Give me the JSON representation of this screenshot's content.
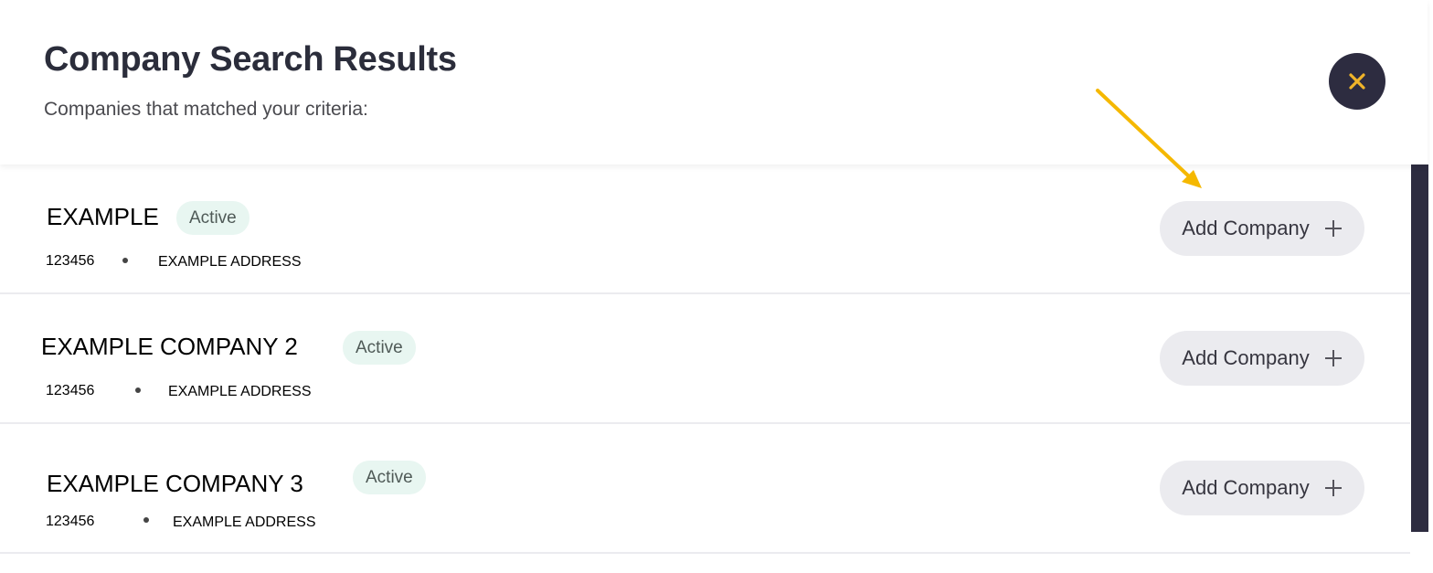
{
  "header": {
    "title": "Company Search Results",
    "subtitle": "Companies that matched your criteria:"
  },
  "close_icon": "close-icon",
  "colors": {
    "accent": "#f0b429",
    "dark": "#2d2c40",
    "badge_bg": "#e8f6f1",
    "button_bg": "#ebebef",
    "annotation_arrow": "#f5b800"
  },
  "results": [
    {
      "name": "EXAMPLE",
      "status": "Active",
      "number": "123456",
      "address": "EXAMPLE ADDRESS",
      "action_label": "Add Company",
      "action_icon": "plus-icon"
    },
    {
      "name": "EXAMPLE COMPANY 2",
      "status": "Active",
      "number": "123456",
      "address": "EXAMPLE ADDRESS",
      "action_label": "Add Company",
      "action_icon": "plus-icon"
    },
    {
      "name": "EXAMPLE COMPANY 3",
      "status": "Active",
      "number": "123456",
      "address": "EXAMPLE ADDRESS",
      "action_label": "Add Company",
      "action_icon": "plus-icon"
    }
  ]
}
